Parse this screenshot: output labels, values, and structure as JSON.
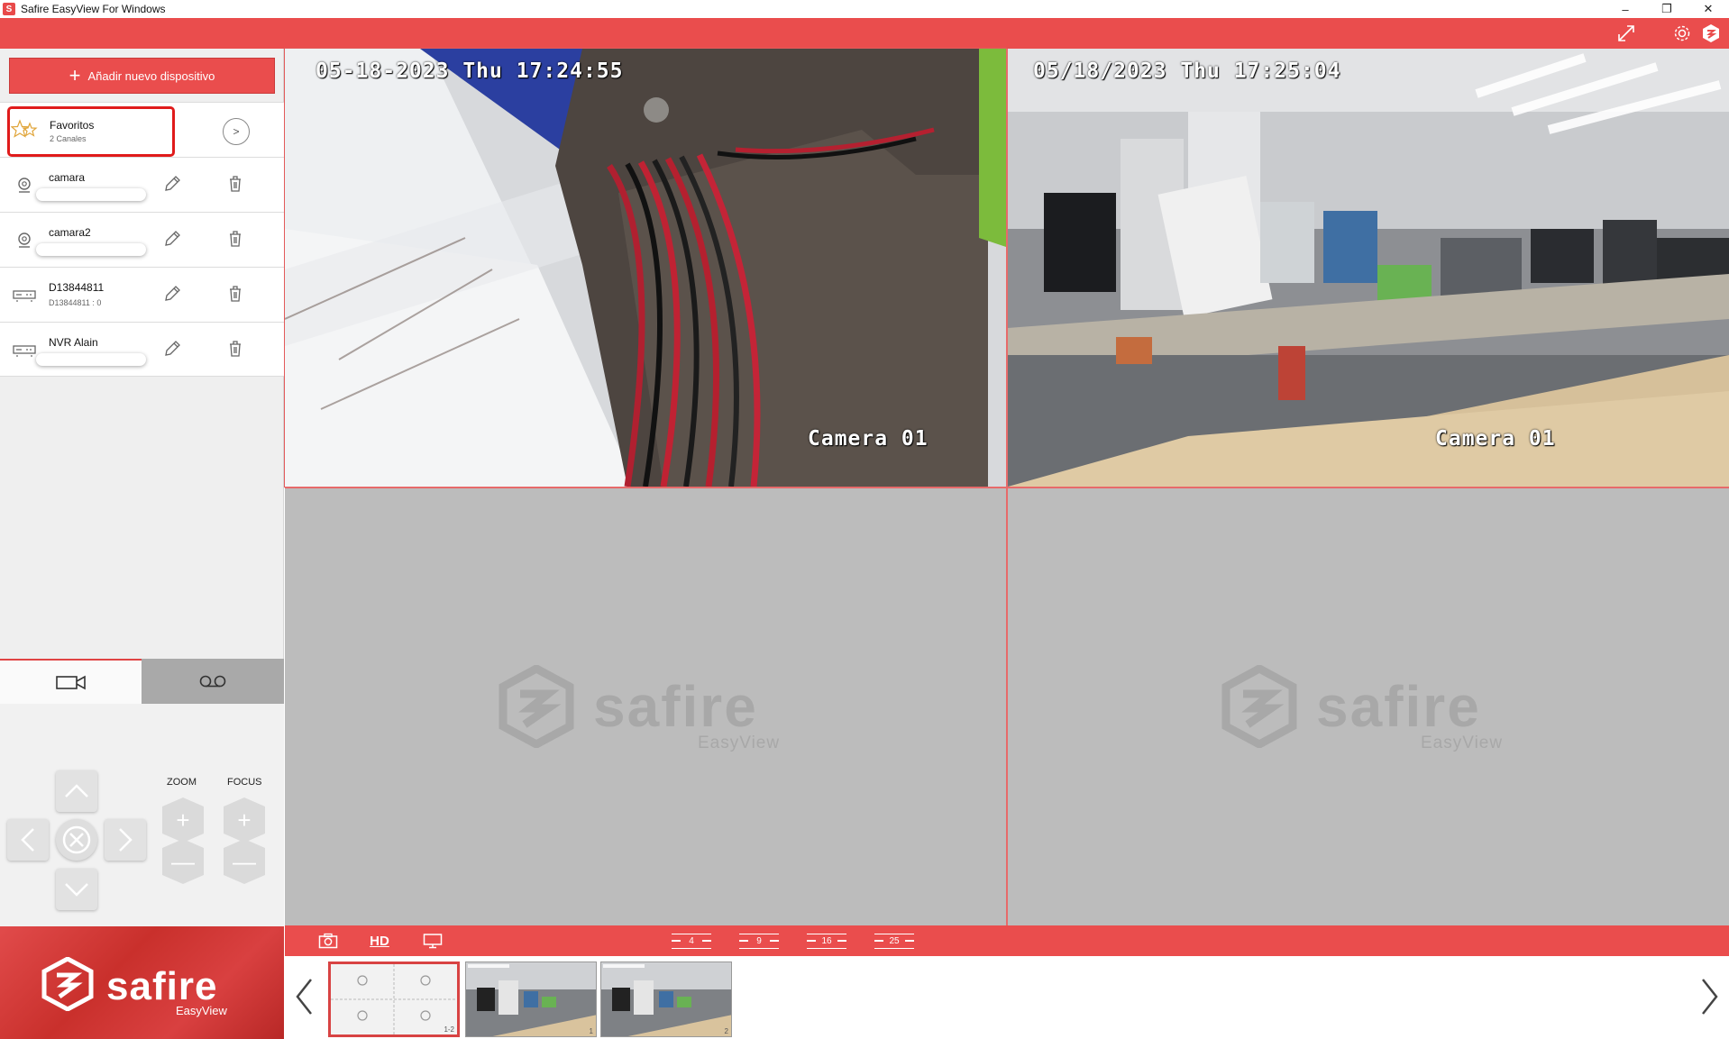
{
  "window": {
    "title": "Safire EasyView For Windows",
    "minimize": "–",
    "restore": "❐",
    "close": "✕"
  },
  "sidebar": {
    "add_device_label": "Añadir nuevo dispositivo",
    "favorites": {
      "name": "Favoritos",
      "sub": "2 Canales",
      "arrow": ">"
    },
    "devices": [
      {
        "name": "camara",
        "type": "camera"
      },
      {
        "name": "camara2",
        "type": "camera"
      },
      {
        "name": "D13844811",
        "sub": "D13844811 : 0",
        "type": "dvr"
      },
      {
        "name": "NVR Alain",
        "type": "dvr"
      }
    ]
  },
  "ptz": {
    "zoom_label": "ZOOM",
    "focus_label": "FOCUS",
    "plus": "+",
    "minus": "—"
  },
  "brand": {
    "name": "safire",
    "sub": "EasyView"
  },
  "video": {
    "cells": [
      {
        "timestamp": "05-18-2023 Thu 17:24:55",
        "label": "Camera 01"
      },
      {
        "timestamp": "05/18/2023 Thu 17:25:04",
        "label": "Camera 01"
      },
      {
        "watermark": "safire",
        "watermark_sub": "EasyView"
      },
      {
        "watermark": "safire",
        "watermark_sub": "EasyView"
      }
    ]
  },
  "bottom_bar": {
    "hd_label": "HD",
    "layouts": [
      "4",
      "9",
      "16",
      "25"
    ]
  },
  "thumbs": [
    {
      "num": "1-2"
    },
    {
      "num": "1"
    },
    {
      "num": "2"
    }
  ],
  "colors": {
    "accent": "#ea4d4d",
    "highlight": "#e01b1b"
  }
}
